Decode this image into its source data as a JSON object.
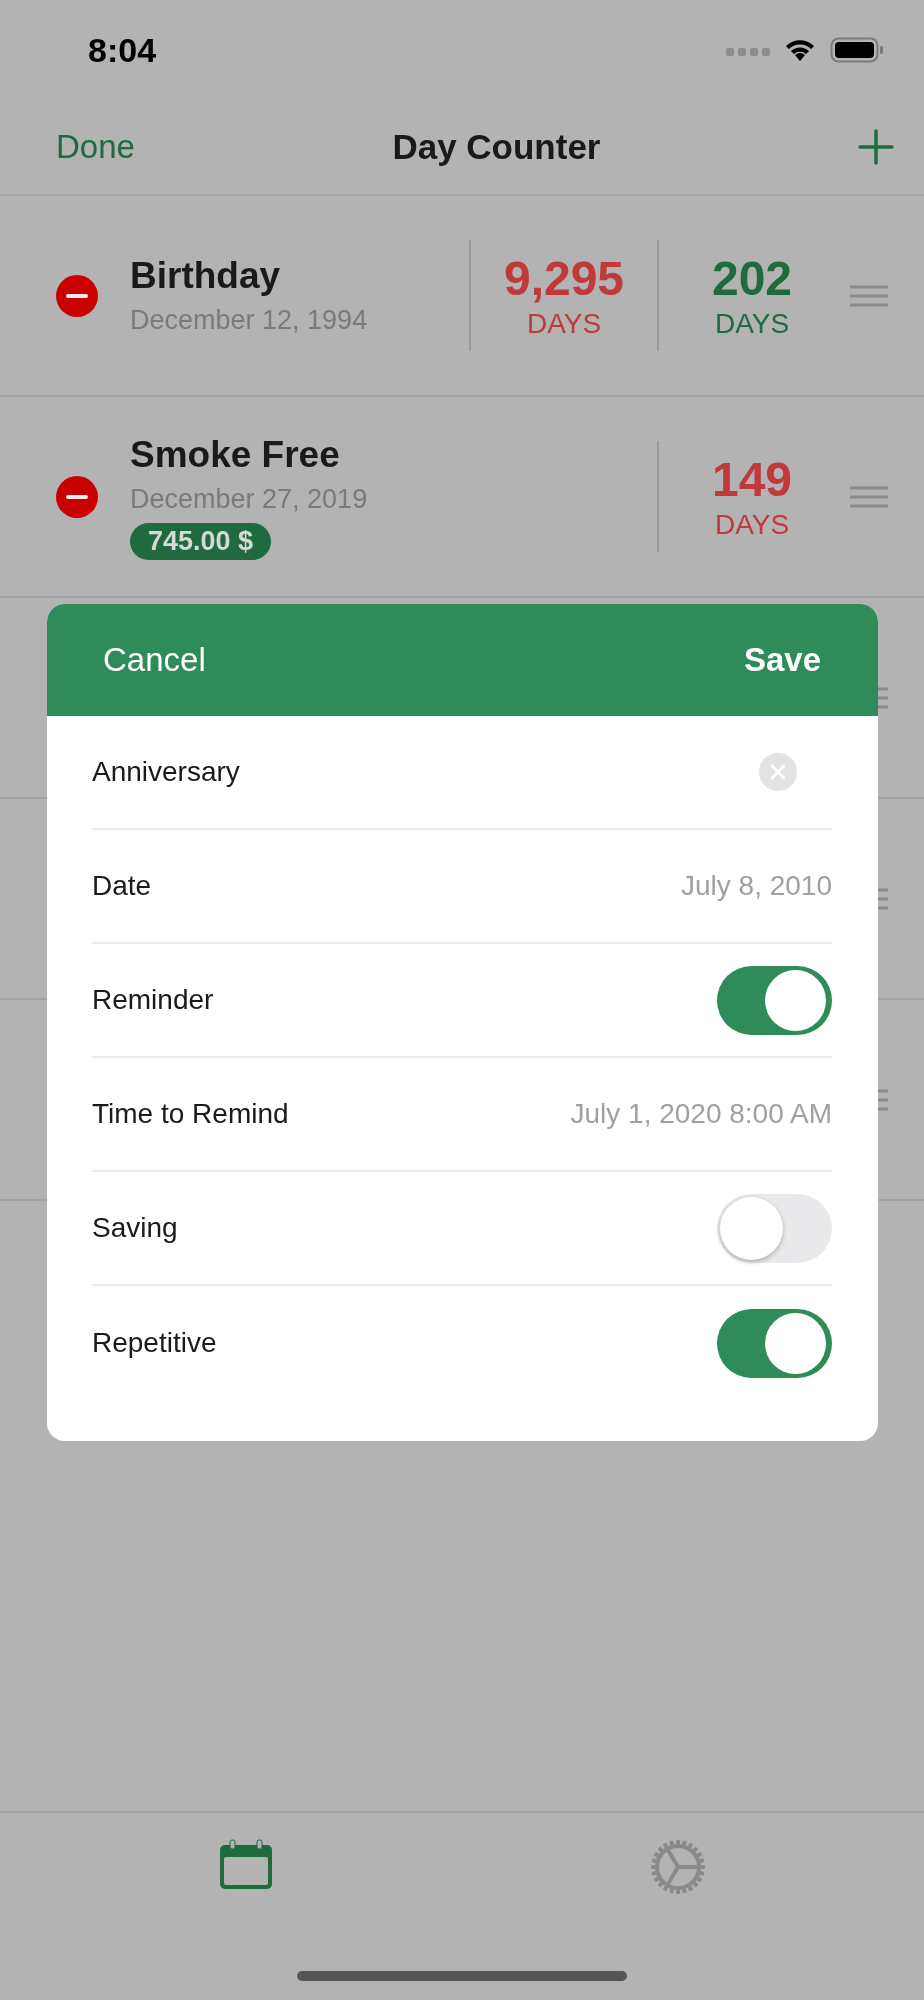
{
  "status_bar": {
    "time": "8:04"
  },
  "nav_bar": {
    "left_button": "Done",
    "title": "Day Counter"
  },
  "events": [
    {
      "kind": "event",
      "name": "Birthday",
      "date": "December 12, 1994",
      "counters": [
        {
          "value": "9,295",
          "unit": "DAYS",
          "color": "#c0393b"
        },
        {
          "value": "202",
          "unit": "DAYS",
          "color": "#1f6a3f"
        }
      ]
    },
    {
      "kind": "event",
      "name": "Smoke Free",
      "date": "December 27, 2019",
      "badge": "745.00 $",
      "counters": [
        {
          "value": "149",
          "unit": "DAYS",
          "color": "#c0393b"
        }
      ]
    },
    {
      "kind": "covered"
    },
    {
      "kind": "covered"
    },
    {
      "kind": "covered"
    }
  ],
  "sheet": {
    "cancel": "Cancel",
    "save": "Save",
    "fields": [
      {
        "kind": "text",
        "value": "Anniversary"
      },
      {
        "kind": "value",
        "label": "Date",
        "value": "July 8, 2010"
      },
      {
        "kind": "toggle",
        "label": "Reminder",
        "on": true
      },
      {
        "kind": "value",
        "label": "Time to Remind",
        "value": "July 1, 2020 8:00 AM"
      },
      {
        "kind": "toggle",
        "label": "Saving",
        "on": false
      },
      {
        "kind": "toggle",
        "label": "Repetitive",
        "on": true
      }
    ]
  },
  "tab_bar": {
    "tabs": [
      {
        "kind": "calendar",
        "selected": true
      },
      {
        "kind": "settings",
        "selected": false
      }
    ]
  }
}
